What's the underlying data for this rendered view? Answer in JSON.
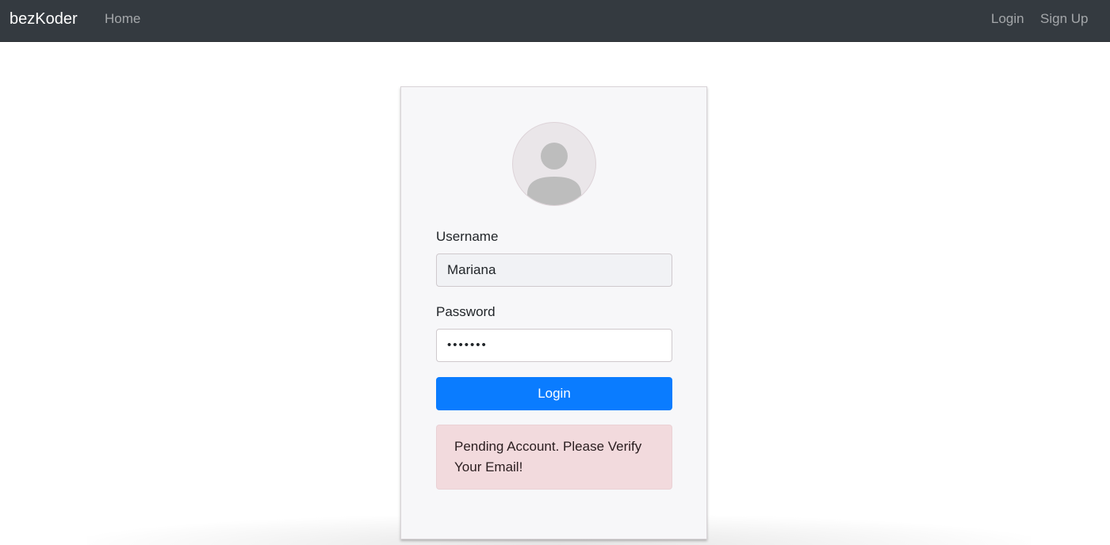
{
  "navbar": {
    "brand": "bezKoder",
    "home_label": "Home",
    "login_label": "Login",
    "signup_label": "Sign Up"
  },
  "login_card": {
    "avatar_icon": "user-avatar-icon",
    "username_label": "Username",
    "username_value": "Mariana",
    "password_label": "Password",
    "password_value": "•••••••",
    "login_button_label": "Login",
    "alert_message": "Pending Account. Please Verify Your Email!"
  },
  "colors": {
    "navbar_bg": "#343a40",
    "primary_button": "#0a7cff",
    "alert_bg": "#f2dadd",
    "card_bg": "#f7f7f9"
  }
}
